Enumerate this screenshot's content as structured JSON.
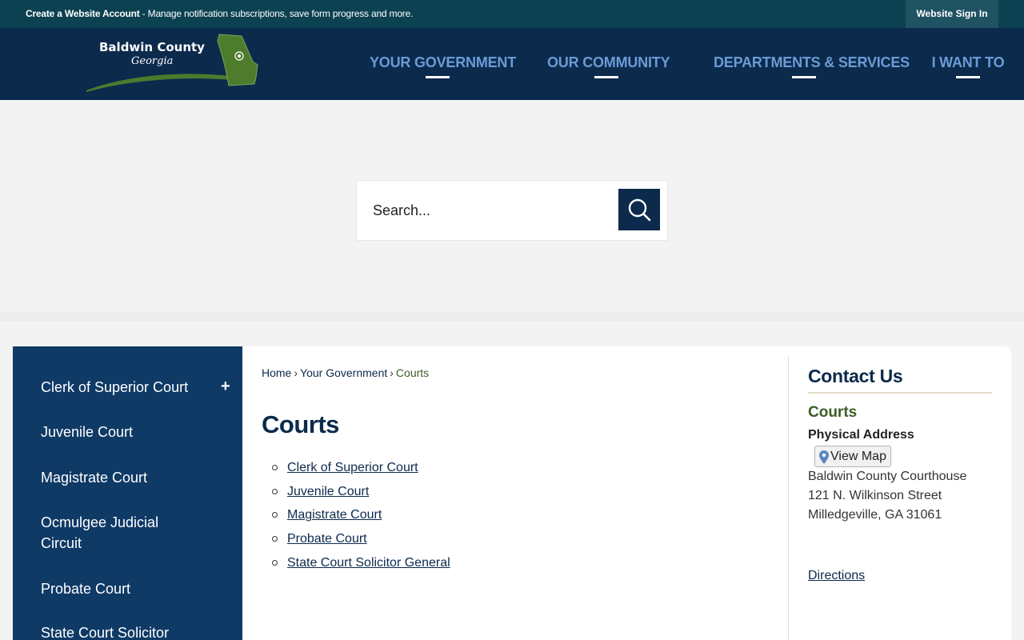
{
  "topbar": {
    "create_account": "Create a Website Account",
    "message": " - Manage notification subscriptions, save form progress and more.",
    "sign_in": "Website Sign In"
  },
  "logo": {
    "line1": "Baldwin County",
    "line2": "Georgia"
  },
  "nav": {
    "items": [
      {
        "label": "YOUR GOVERNMENT"
      },
      {
        "label": "OUR COMMUNITY"
      },
      {
        "label": "DEPARTMENTS & SERVICES"
      },
      {
        "label": "I WANT TO"
      }
    ]
  },
  "search": {
    "placeholder": "Search..."
  },
  "sidebar": {
    "items": [
      {
        "label": "Clerk of Superior Court"
      },
      {
        "label": "Juvenile Court"
      },
      {
        "label": "Magistrate Court"
      },
      {
        "label": "Ocmulgee Judicial",
        "label2": "Circuit"
      },
      {
        "label": "Probate Court"
      },
      {
        "label": "State Court Solicitor"
      }
    ],
    "expand_symbol": "+"
  },
  "breadcrumb": {
    "home": "Home",
    "parent": "Your Government",
    "current": "Courts",
    "separator": "›"
  },
  "main": {
    "title": "Courts",
    "links": [
      "Clerk of Superior Court",
      "Juvenile Court",
      "Magistrate Court",
      "Probate Court",
      "State Court Solicitor General"
    ]
  },
  "contact": {
    "title": "Contact Us",
    "department": "Courts",
    "address_label": "Physical Address",
    "view_map": "View Map",
    "address": [
      "Baldwin County Courthouse",
      "121 N. Wilkinson Street",
      "Milledgeville, GA 31061"
    ],
    "directions": "Directions"
  },
  "colors": {
    "topbar": "#0b4150",
    "header": "#0c2a4c",
    "nav_text": "#6b9bd6",
    "sidebar": "#0f3a66",
    "accent_green": "#3b5d27"
  }
}
